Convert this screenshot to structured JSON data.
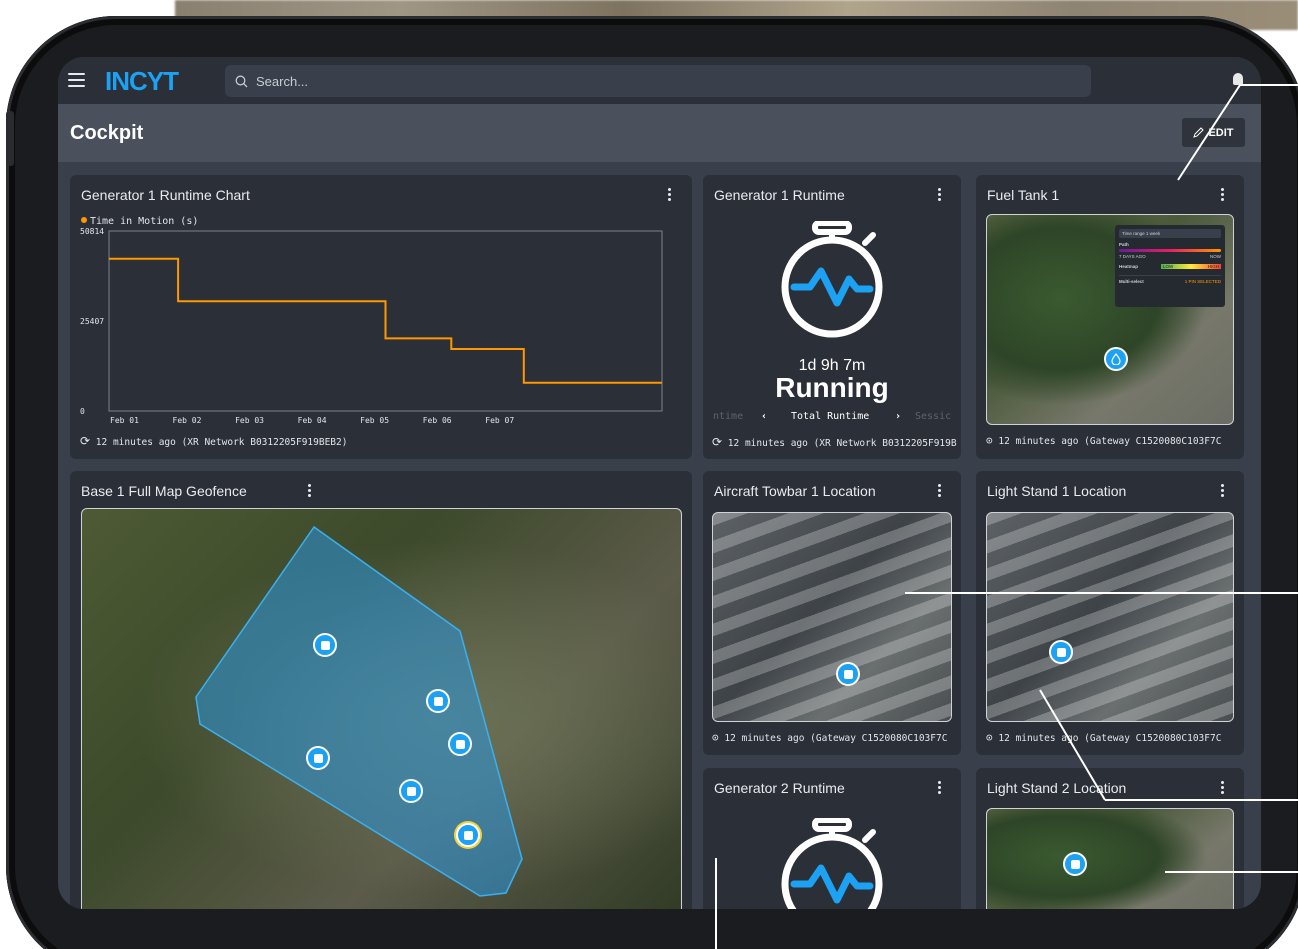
{
  "app": {
    "logo": "INCYT",
    "search_placeholder": "Search..."
  },
  "page": {
    "title": "Cockpit",
    "edit_label": "EDIT"
  },
  "cards": {
    "gen1_chart": {
      "title": "Generator 1 Runtime Chart",
      "footer": "12 minutes ago (XR Network B0312205F919BEB2)"
    },
    "gen1_runtime": {
      "title": "Generator 1 Runtime",
      "duration": "1d 9h 7m",
      "status": "Running",
      "tab_left": "ntime",
      "tab_center": "Total Runtime",
      "tab_right": "Sessic",
      "footer": "12 minutes ago (XR Network B0312205F919BEB"
    },
    "fuel_tank": {
      "title": "Fuel Tank 1",
      "footer": "12 minutes ago (Gateway C1520080C103F7C",
      "overlay": {
        "time_range": "Time range 1 week",
        "path": "Path",
        "days_ago": "7 DAYS AGO",
        "now": "NOW",
        "heatmap": "Heatmap",
        "heat_low": "LOW",
        "heat_high": "HIGH",
        "multi_select": "Multi-select",
        "pin_selected": "1 PIN SELECTED"
      }
    },
    "base_map": {
      "title": "Base 1 Full Map Geofence"
    },
    "towbar": {
      "title": "Aircraft Towbar 1 Location",
      "footer": "12 minutes ago (Gateway C1520080C103F7C"
    },
    "light1": {
      "title": "Light Stand 1 Location",
      "footer": "12 minutes ago (Gateway C1520080C103F7C"
    },
    "gen2_runtime": {
      "title": "Generator 2 Runtime"
    },
    "light2": {
      "title": "Light Stand 2 Location"
    }
  },
  "chart_data": {
    "type": "line",
    "title": "",
    "series": [
      {
        "name": "Time in Motion (s)",
        "color": "#ff9800",
        "points": [
          [
            0,
            43000
          ],
          [
            1.05,
            43000
          ],
          [
            1.05,
            31000
          ],
          [
            4.2,
            31000
          ],
          [
            4.2,
            20500
          ],
          [
            5.2,
            20500
          ],
          [
            5.2,
            17500
          ],
          [
            6.3,
            17500
          ],
          [
            6.3,
            8000
          ],
          [
            8.4,
            8000
          ]
        ]
      }
    ],
    "x_tick_labels": [
      "Feb 01",
      "Feb 02",
      "Feb 03",
      "Feb 04",
      "Feb 05",
      "Feb 06",
      "Feb 07"
    ],
    "y_tick_labels": [
      "50814",
      "25407",
      "0"
    ],
    "ylim": [
      0,
      50814
    ],
    "xlim": [
      0,
      8.4
    ],
    "legend_position": "top-left",
    "grid": false
  },
  "colors": {
    "accent": "#1da1f2",
    "series": "#ff9800",
    "card": "#2b2f38",
    "topbar": "#2a2f38"
  }
}
